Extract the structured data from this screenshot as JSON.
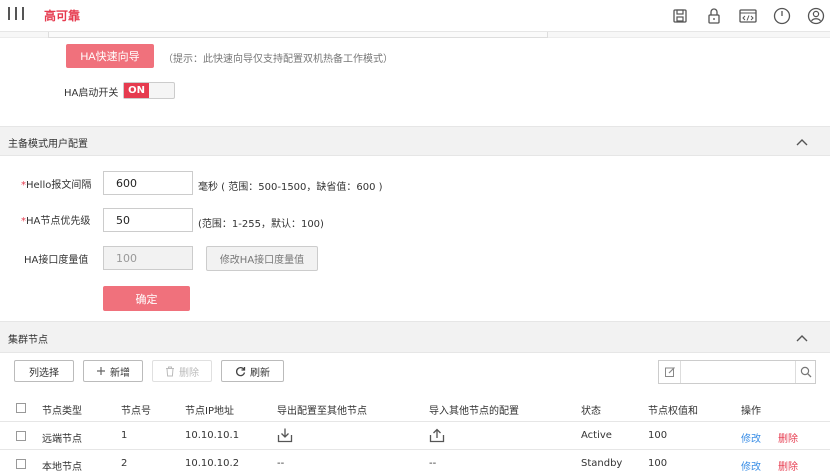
{
  "header": {
    "app_title": "高可靠",
    "icons": [
      "save-icon",
      "lock-icon",
      "code-icon",
      "power-icon",
      "user-icon"
    ]
  },
  "wizard": {
    "button_label": "HA快速向导",
    "hint": "（提示：此快速向导仅支持配置双机热备工作模式）"
  },
  "ha_switch": {
    "label": "HA启动开关",
    "state": "ON"
  },
  "master_config": {
    "section_title": "主备模式用户配置",
    "hello": {
      "required_mark": "*",
      "label": "Hello报文间隔",
      "value": "600",
      "hint": "毫秒 ( 范围：500-1500，缺省值：600 )"
    },
    "priority": {
      "required_mark": "*",
      "label": "HA节点优先级",
      "value": "50",
      "hint": "(范围：1-255，默认：100)"
    },
    "metric": {
      "label": "HA接口度量值",
      "value": "100",
      "modify_button": "修改HA接口度量值"
    },
    "confirm_button": "确定"
  },
  "cluster": {
    "section_title": "集群节点",
    "toolbar": {
      "column_select": "列选择",
      "add": "新增",
      "delete": "删除",
      "refresh": "刷新"
    },
    "columns": [
      "节点类型",
      "节点号",
      "节点IP地址",
      "导出配置至其他节点",
      "导入其他节点的配置",
      "状态",
      "节点权值和",
      "操作"
    ],
    "rows": [
      {
        "type": "远端节点",
        "id": "1",
        "ip": "10.10.10.1",
        "export": "export-icon",
        "import": "import-icon",
        "status": "Active",
        "weight": "100",
        "edit": "修改",
        "delete": "删除"
      },
      {
        "type": "本地节点",
        "id": "2",
        "ip": "10.10.10.2",
        "export": "--",
        "import": "--",
        "status": "Standby",
        "weight": "100",
        "edit": "修改",
        "delete": "删除"
      }
    ]
  },
  "colors": {
    "accent": "#e63b4f",
    "primary_button": "#f0717c",
    "link": "#3a8ee6",
    "section_bg": "#f2f2f2"
  }
}
